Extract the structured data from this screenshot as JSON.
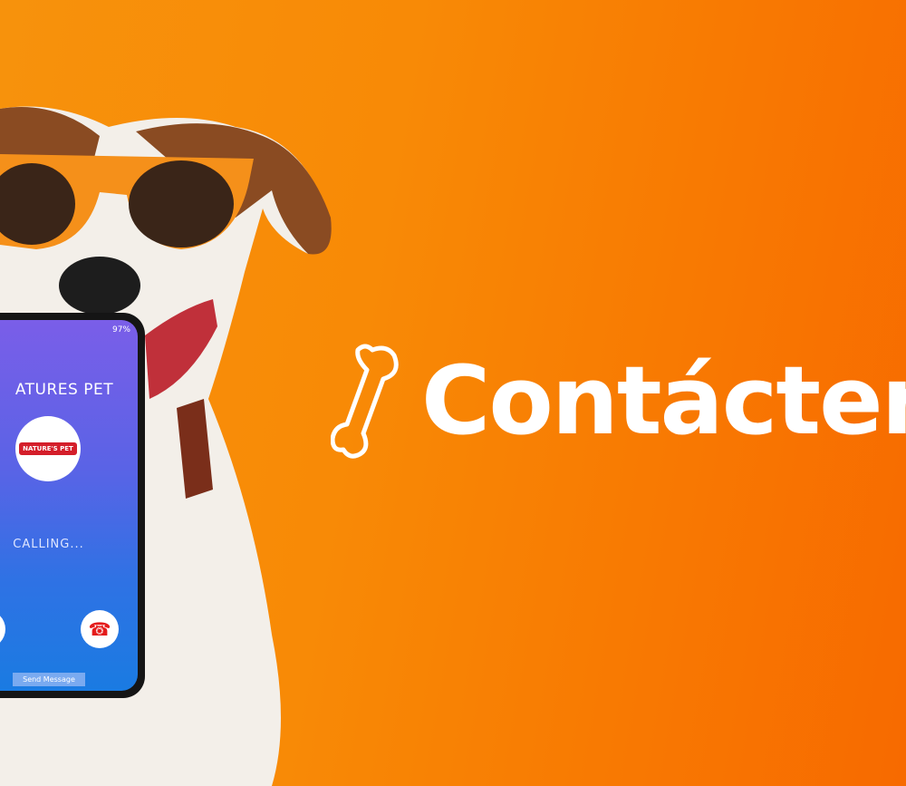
{
  "phone": {
    "status": "97%",
    "caller_name": "ATURES PET",
    "logo_text": "NATURE'S PET",
    "call_status": "CALLING...",
    "send_message": "Send Message"
  },
  "headline": "Contácten",
  "colors": {
    "background": "#f88a06",
    "phone_top": "#7a5ee8",
    "phone_bottom": "#1a7be2",
    "end_call": "#e41c1c"
  }
}
